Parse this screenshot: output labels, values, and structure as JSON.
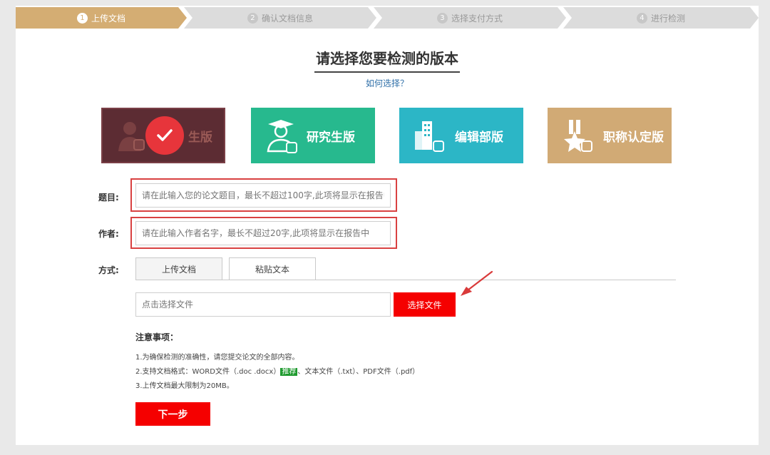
{
  "steps": [
    {
      "num": "1",
      "label": "上传文档"
    },
    {
      "num": "2",
      "label": "确认文档信息"
    },
    {
      "num": "3",
      "label": "选择支付方式"
    },
    {
      "num": "4",
      "label": "进行检测"
    }
  ],
  "heading": "请选择您要检测的版本",
  "how_to_choose": "如何选择？",
  "versions": [
    {
      "label": "生版",
      "selected": true
    },
    {
      "label": "研究生版",
      "selected": false
    },
    {
      "label": "编辑部版",
      "selected": false
    },
    {
      "label": "职称认定版",
      "selected": false
    }
  ],
  "form": {
    "title_label": "题目:",
    "title_placeholder": "请在此输入您的论文题目，最长不超过100字,此项将显示在报告中",
    "author_label": "作者:",
    "author_placeholder": "请在此输入作者名字，最长不超过20字,此项将显示在报告中",
    "method_label": "方式:",
    "tabs": [
      "上传文档",
      "粘贴文本"
    ],
    "file_placeholder": "点击选择文件",
    "choose_file": "选择文件"
  },
  "notes": {
    "title": "注意事项：",
    "line1": "1.为确保检测的准确性，请您提交论文的全部内容。",
    "line2_a": "2.支持文档格式：WORD文件（.doc .docx）",
    "line2_tag": "推荐",
    "line2_b": "、文本文件（.txt）、PDF文件（.pdf）",
    "line3": "3.上传文档最大限制为20MB。"
  },
  "next_button": "下一步",
  "colors": {
    "accent_gold": "#d4ad73",
    "red": "#f50000",
    "green": "#27b98e",
    "teal": "#2cb6c6",
    "tag_green": "#1e9a2e"
  }
}
